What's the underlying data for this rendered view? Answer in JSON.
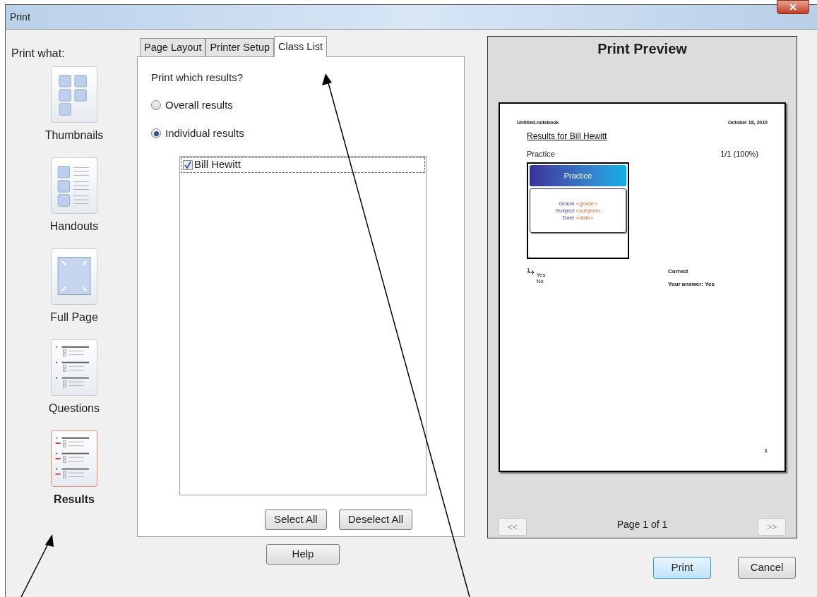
{
  "window": {
    "title": "Print"
  },
  "print_what": {
    "label": "Print what:",
    "items": [
      {
        "kind": "thumbnails",
        "label": "Thumbnails",
        "selected": false
      },
      {
        "kind": "handouts",
        "label": "Handouts",
        "selected": false
      },
      {
        "kind": "full_page",
        "label": "Full Page",
        "selected": false
      },
      {
        "kind": "questions",
        "label": "Questions",
        "selected": false
      },
      {
        "kind": "results",
        "label": "Results",
        "selected": true
      }
    ]
  },
  "tabs": [
    {
      "label": "Page Layout",
      "selected": false
    },
    {
      "label": "Printer Setup",
      "selected": false
    },
    {
      "label": "Class List",
      "selected": true
    }
  ],
  "class_list": {
    "question": "Print which results?",
    "options": [
      {
        "label": "Overall results",
        "selected": false
      },
      {
        "label": "Individual results",
        "selected": true
      }
    ],
    "students": [
      {
        "name": "Bill Hewitt",
        "checked": true
      }
    ],
    "buttons": [
      "Select All",
      "Deselect All"
    ]
  },
  "help_button": "Help",
  "preview": {
    "title": "Print Preview",
    "page": {
      "file": "Untitled.notebook",
      "date": "October 18, 2010",
      "heading": "Results for Bill Hewitt",
      "question": "Practice",
      "score": "1/1 (100%)",
      "slide": {
        "title": "Practice",
        "lines": [
          {
            "label": "Grade",
            "value": "<grade>"
          },
          {
            "label": "Subject",
            "value": "<subject>"
          },
          {
            "label": "Date",
            "value": "<date>"
          }
        ]
      },
      "number": "1",
      "choices": [
        "Yes",
        "No"
      ],
      "result": "Correct",
      "answer": "Your answer: Yes",
      "page_number": "1"
    },
    "prev": {
      "label": "<<",
      "disabled": true
    },
    "next": {
      "label": ">>",
      "disabled": true
    },
    "page_status": "Page 1 of 1"
  },
  "buttons": [
    {
      "label": "Print",
      "default": true
    },
    {
      "label": "Cancel",
      "default": false
    }
  ]
}
